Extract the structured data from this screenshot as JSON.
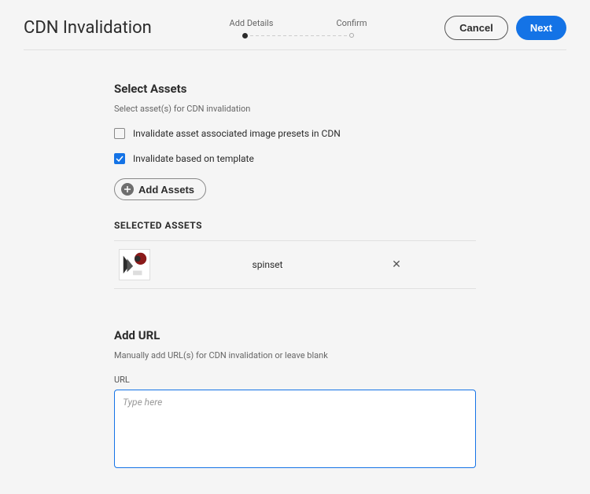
{
  "header": {
    "title": "CDN Invalidation",
    "steps": {
      "addDetails": "Add Details",
      "confirm": "Confirm"
    },
    "cancelLabel": "Cancel",
    "nextLabel": "Next"
  },
  "selectAssets": {
    "title": "Select Assets",
    "desc": "Select asset(s) for CDN invalidation",
    "checkbox1": "Invalidate asset associated image presets in CDN",
    "checkbox2": "Invalidate based on template",
    "addAssetsLabel": "Add Assets",
    "selectedTitle": "SELECTED ASSETS",
    "items": [
      {
        "name": "spinset"
      }
    ]
  },
  "addUrl": {
    "title": "Add URL",
    "desc": "Manually add URL(s) for CDN invalidation or leave blank",
    "label": "URL",
    "placeholder": "Type here"
  }
}
